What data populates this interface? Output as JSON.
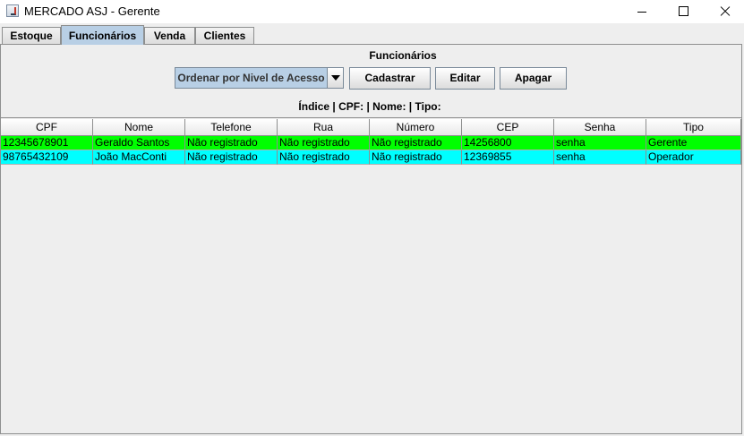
{
  "window": {
    "title": "MERCADO ASJ - Gerente"
  },
  "tabs": [
    {
      "label": "Estoque"
    },
    {
      "label": "Funcionários"
    },
    {
      "label": "Venda"
    },
    {
      "label": "Clientes"
    }
  ],
  "active_tab": "Funcionários",
  "panel": {
    "title": "Funcionários",
    "sort_combo": {
      "selected": "Ordenar por Nivel de Acesso"
    },
    "buttons": {
      "register": "Cadastrar",
      "edit": "Editar",
      "delete": "Apagar"
    },
    "info_line": "Índice | CPF: | Nome: | Tipo:"
  },
  "table": {
    "columns": [
      "CPF",
      "Nome",
      "Telefone",
      "Rua",
      "Número",
      "CEP",
      "Senha",
      "Tipo"
    ],
    "rows": [
      {
        "cells": [
          "12345678901",
          "Geraldo Santos",
          "Não registrado",
          "Não registrado",
          "Não registrado",
          "14256800",
          "senha",
          "Gerente"
        ],
        "color": "#00ff00"
      },
      {
        "cells": [
          "98765432109",
          "João MacConti",
          "Não registrado",
          "Não registrado",
          "Não registrado",
          "12369855",
          "senha",
          "Operador"
        ],
        "color": "#00ffff"
      }
    ]
  }
}
